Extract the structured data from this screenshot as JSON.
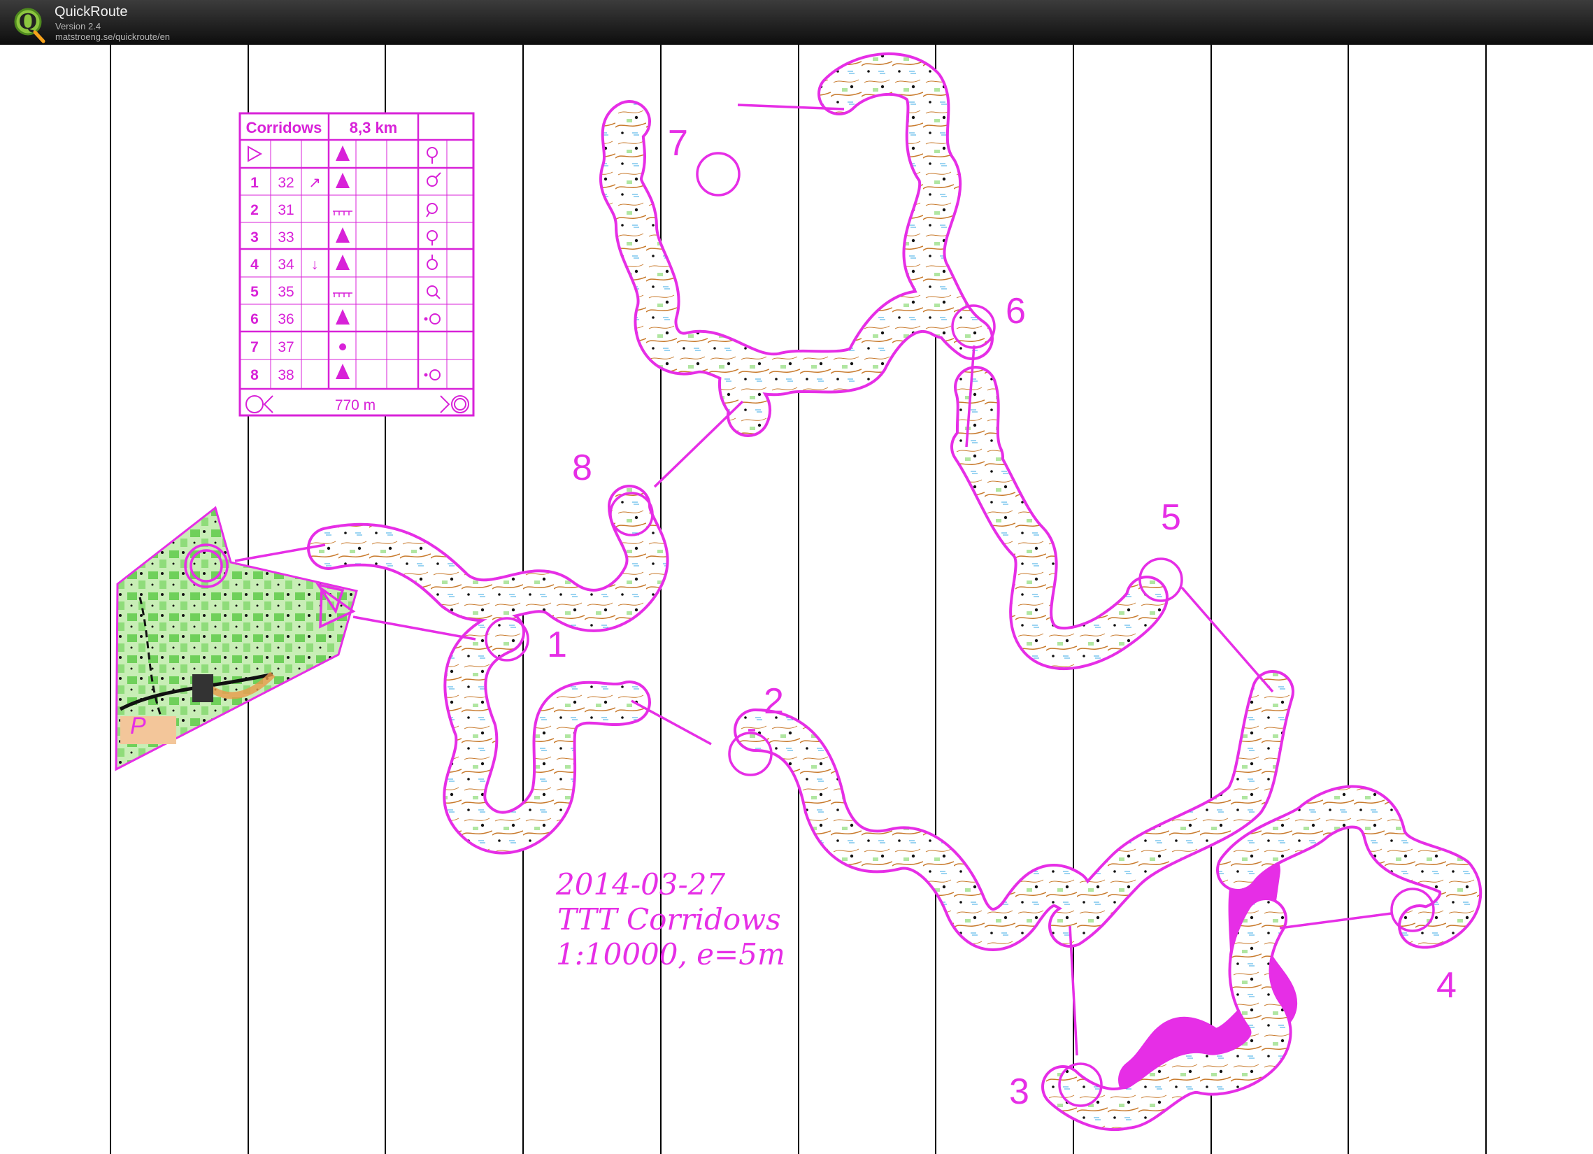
{
  "app": {
    "title": "QuickRoute",
    "version": "Version 2.4",
    "url": "matstroeng.se/quickroute/en",
    "logo_letter": "Q"
  },
  "map": {
    "title_lines": [
      "2014-03-27",
      "TTT Corridows",
      "1:10000, e=5m"
    ],
    "start_symbol": "triangle",
    "parking_label": "P",
    "control_labels": {
      "c1": "1",
      "c2": "2",
      "c3": "3",
      "c4": "4",
      "c5": "5",
      "c6": "6",
      "c7": "7",
      "c8": "8"
    },
    "corridor_color": "#e62ee6"
  },
  "control_descriptions": {
    "event": "Corridows",
    "length": "8,3 km",
    "rows": [
      {
        "num": "1",
        "code": "32",
        "dir": "↗"
      },
      {
        "num": "2",
        "code": "31",
        "dir": ""
      },
      {
        "num": "3",
        "code": "33",
        "dir": ""
      },
      {
        "num": "4",
        "code": "34",
        "dir": "↓"
      },
      {
        "num": "5",
        "code": "35",
        "dir": ""
      },
      {
        "num": "6",
        "code": "36",
        "dir": ""
      },
      {
        "num": "7",
        "code": "37",
        "dir": ""
      },
      {
        "num": "8",
        "code": "38",
        "dir": ""
      }
    ],
    "finish_distance": "770 m"
  }
}
